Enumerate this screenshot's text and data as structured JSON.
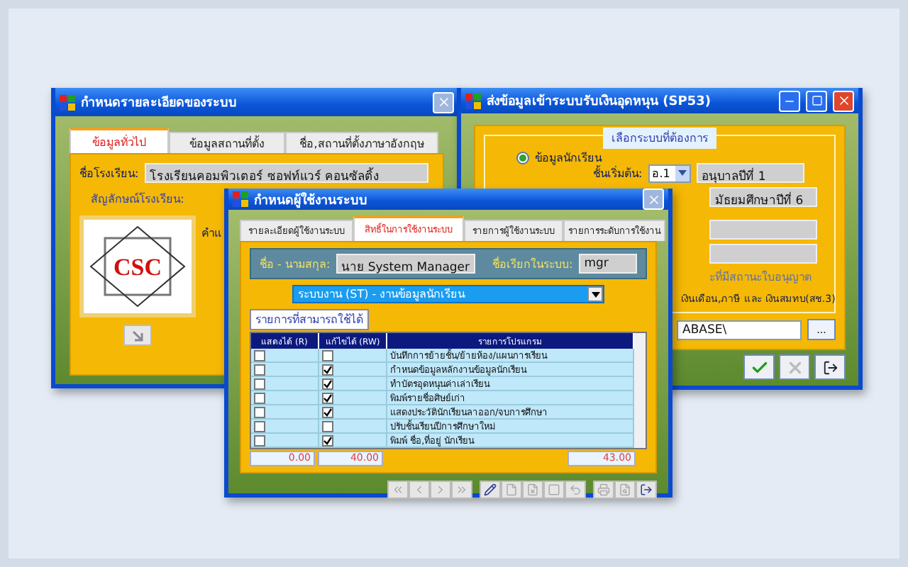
{
  "school_window": {
    "title": "กำหนดรายละเอียดของระบบ",
    "controls": [
      {
        "kind": "close",
        "disabled": true
      }
    ],
    "tabs": [
      {
        "label": "ข้อมูลทั่วไป",
        "selected": true
      },
      {
        "label": "ข้อมูลสถานที่ตั้ง",
        "selected": false
      },
      {
        "label": "ชื่อ,สถานที่ตั้งภาษาอังกฤษ",
        "selected": false
      }
    ],
    "name_label": "ชื่อโรงเรียน:",
    "name_value": "โรงเรียนคอมพิวเตอร์ ซอฟท์แวร์ คอนซัลติ้ง",
    "logo_label": "สัญลักษณ์โรงเรียน:",
    "logo_text": "CSC",
    "cut_label": "คำแ"
  },
  "export_window": {
    "title": "ส่งข้อมูลเข้าระบบรับเงินอุดหนุน (SP53)",
    "controls": [
      {
        "kind": "minimize",
        "disabled": false
      },
      {
        "kind": "maximize",
        "disabled": false
      },
      {
        "kind": "close",
        "disabled": false
      }
    ],
    "group_title": "เลือกระบบที่ต้องการ",
    "option": {
      "label": "ข้อมูลนักเรียน",
      "selected": true
    },
    "start_label": "ชั้นเริ่มต้น:",
    "start_code": "อ.1",
    "start_name": "อนุบาลปีที่ 1",
    "end_name": "มัธยมศึกษาปีที่ 6",
    "note": "ะที่มีสถานะใบอนุญาต",
    "salary_option": "เงินเดือน,ภาษี และ เงินสมทบ(สช.3)",
    "path": "ABASE\\",
    "browse": "...",
    "buttons": [
      {
        "kind": "ok",
        "disabled": false
      },
      {
        "kind": "cancel",
        "disabled": true
      },
      {
        "kind": "exit",
        "disabled": false
      }
    ]
  },
  "user_window": {
    "title": "กำหนดผู้ใช้งานระบบ",
    "controls": [
      {
        "kind": "close",
        "disabled": true
      }
    ],
    "tabs": [
      {
        "label": "รายละเอียดผู้ใช้งานระบบ",
        "selected": false
      },
      {
        "label": "สิทธิ์ในการใช้งานระบบ",
        "selected": true
      },
      {
        "label": "รายการผู้ใช้งานระบบ",
        "selected": false
      },
      {
        "label": "รายการระดับการใช้งาน",
        "selected": false
      }
    ],
    "fullname_label": "ชื่อ - นามสกุล:",
    "fullname": "นาย System Manager",
    "login_label": "ชื่อเรียกในระบบ:",
    "login": "mgr",
    "system": "ระบบงาน (ST) - งานข้อมูลนักเรียน",
    "group_title": "รายการที่สามารถใช้ได้",
    "table": {
      "columns": [
        "แสดงได้ (R)",
        "แก้ไขได้ (RW)",
        "รายการโปรแกรม"
      ],
      "rows": [
        {
          "read": false,
          "write": false,
          "program": "บันทึกการย้ายชั้น/ย้ายห้อง/แผนการเรียน"
        },
        {
          "read": false,
          "write": true,
          "program": "กำหนดข้อมูลหลักงานข้อมูลนักเรียน"
        },
        {
          "read": false,
          "write": true,
          "program": "ทำบัตรอุดหนุนค่าเล่าเรียน"
        },
        {
          "read": false,
          "write": true,
          "program": "พิมพ์รายชื่อศิษย์เก่า"
        },
        {
          "read": false,
          "write": true,
          "program": "แสดงประวัตินักเรียนลาออก/จบการศึกษา"
        },
        {
          "read": false,
          "write": false,
          "program": "ปรับชั้นเรียนปีการศึกษาใหม่"
        },
        {
          "read": false,
          "write": true,
          "program": "พิมพ์ ชื่อ,ที่อยู่ นักเรียน"
        }
      ],
      "totals": [
        "0.00",
        "40.00",
        "43.00"
      ]
    },
    "toolbar": [
      {
        "kind": "first",
        "disabled": true
      },
      {
        "kind": "prev",
        "disabled": true
      },
      {
        "kind": "next",
        "disabled": true
      },
      {
        "kind": "last",
        "disabled": true
      },
      {
        "kind": "edit",
        "disabled": false
      },
      {
        "kind": "new",
        "disabled": true
      },
      {
        "kind": "delete",
        "disabled": true
      },
      {
        "kind": "save",
        "disabled": true
      },
      {
        "kind": "undo",
        "disabled": true
      },
      {
        "kind": "print",
        "disabled": true
      },
      {
        "kind": "preview",
        "disabled": true
      },
      {
        "kind": "exit",
        "disabled": false
      }
    ]
  }
}
